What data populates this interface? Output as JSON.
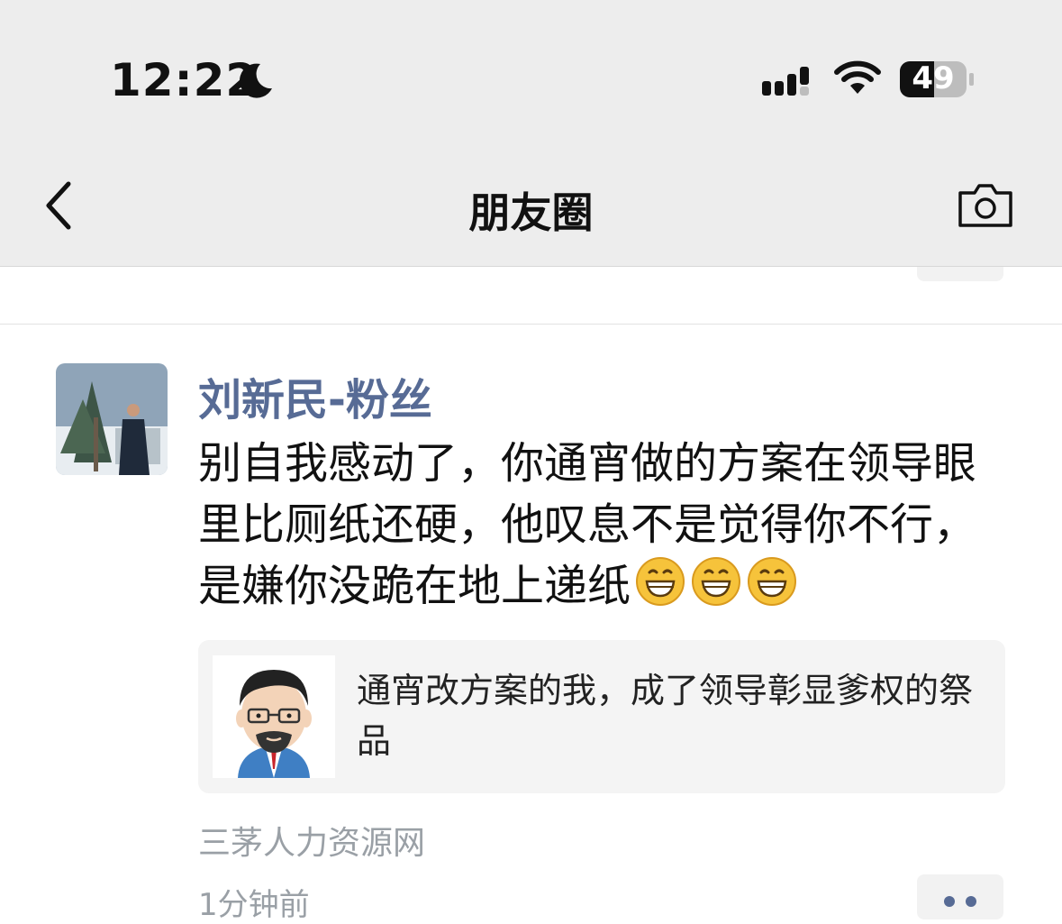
{
  "status_bar": {
    "time": "12:22",
    "battery": "49",
    "icons": [
      "moon-icon",
      "signal-icon",
      "wifi-icon",
      "battery-icon"
    ]
  },
  "nav": {
    "title": "朋友圈",
    "back_icon": "chevron-left-icon",
    "camera_icon": "camera-icon"
  },
  "post": {
    "author": "刘新民-粉丝",
    "text": "别自我感动了，你通宵做的方案在领导眼里比厕纸还硬，他叹息不是觉得你不行，是嫌你没跪在地上递纸",
    "emojis": [
      "grin-emoji",
      "grin-emoji",
      "grin-emoji"
    ],
    "link": {
      "title": "通宵改方案的我，成了领导彰显爹权的祭品"
    },
    "source": "三茅人力资源网",
    "time": "1分钟前"
  },
  "colors": {
    "bar_bg": "#ededed",
    "author": "#576b95",
    "meta_gray": "#9aa0a6",
    "card_bg": "#f4f4f4"
  }
}
